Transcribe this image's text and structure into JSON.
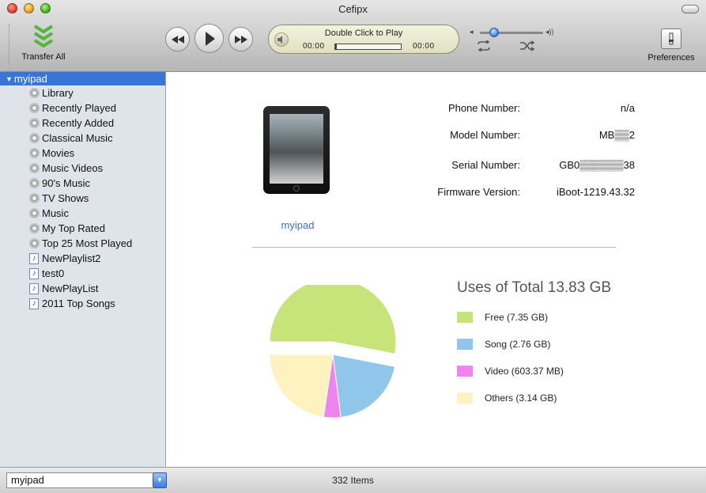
{
  "window": {
    "title": "Cefipx"
  },
  "toolbar": {
    "transfer_label": "Transfer All",
    "preferences_label": "Preferences",
    "now_playing": "Double Click to Play",
    "elapsed": "00:00",
    "remaining": "00:00",
    "progress": 0,
    "volume": 0.15
  },
  "sidebar": {
    "device": "myipad",
    "items": [
      {
        "label": "Library",
        "icon": "library-icon"
      },
      {
        "label": "Recently Played",
        "icon": "smart-playlist-icon"
      },
      {
        "label": "Recently Added",
        "icon": "smart-playlist-icon"
      },
      {
        "label": "Classical Music",
        "icon": "smart-playlist-icon"
      },
      {
        "label": "Movies",
        "icon": "smart-playlist-icon"
      },
      {
        "label": "Music Videos",
        "icon": "smart-playlist-icon"
      },
      {
        "label": "90's Music",
        "icon": "smart-playlist-icon"
      },
      {
        "label": "TV Shows",
        "icon": "smart-playlist-icon"
      },
      {
        "label": "Music",
        "icon": "smart-playlist-icon"
      },
      {
        "label": "My Top Rated",
        "icon": "smart-playlist-icon"
      },
      {
        "label": "Top 25 Most Played",
        "icon": "smart-playlist-icon"
      },
      {
        "label": "NewPlaylist2",
        "icon": "playlist-icon"
      },
      {
        "label": "test0",
        "icon": "playlist-icon"
      },
      {
        "label": "NewPlayList",
        "icon": "playlist-icon"
      },
      {
        "label": "2011 Top Songs",
        "icon": "playlist-icon"
      }
    ]
  },
  "device_info": {
    "name": "myipad",
    "phone_label": "Phone Number:",
    "phone_value": "n/a",
    "model_label": "Model Number:",
    "model_value": "MB▒▒2",
    "serial_label": "Serial Number:",
    "serial_value": "GB0▒▒▒▒▒▒38",
    "firmware_label": "Firmware Version:",
    "firmware_value": "iBoot-1219.43.32"
  },
  "usage": {
    "title": "Uses of Total 13.83 GB",
    "legend": [
      {
        "label": "Free (7.35 GB)",
        "color": "#c6e47a"
      },
      {
        "label": "Song (2.76 GB)",
        "color": "#8fc6ea"
      },
      {
        "label": "Video (603.37 MB)",
        "color": "#ee84ee"
      },
      {
        "label": "Others (3.14 GB)",
        "color": "#fef2c0"
      }
    ]
  },
  "chart_data": {
    "type": "pie",
    "title": "Uses of Total 13.83 GB",
    "labels": [
      "Free",
      "Song",
      "Video",
      "Others"
    ],
    "values": [
      7.35,
      2.76,
      0.60337,
      3.14
    ],
    "colors": [
      "#c6e47a",
      "#8fc6ea",
      "#ee84ee",
      "#fef2c0"
    ],
    "exploded": "Free"
  },
  "footer": {
    "device_select": "myipad",
    "items_count": "332 Items"
  }
}
